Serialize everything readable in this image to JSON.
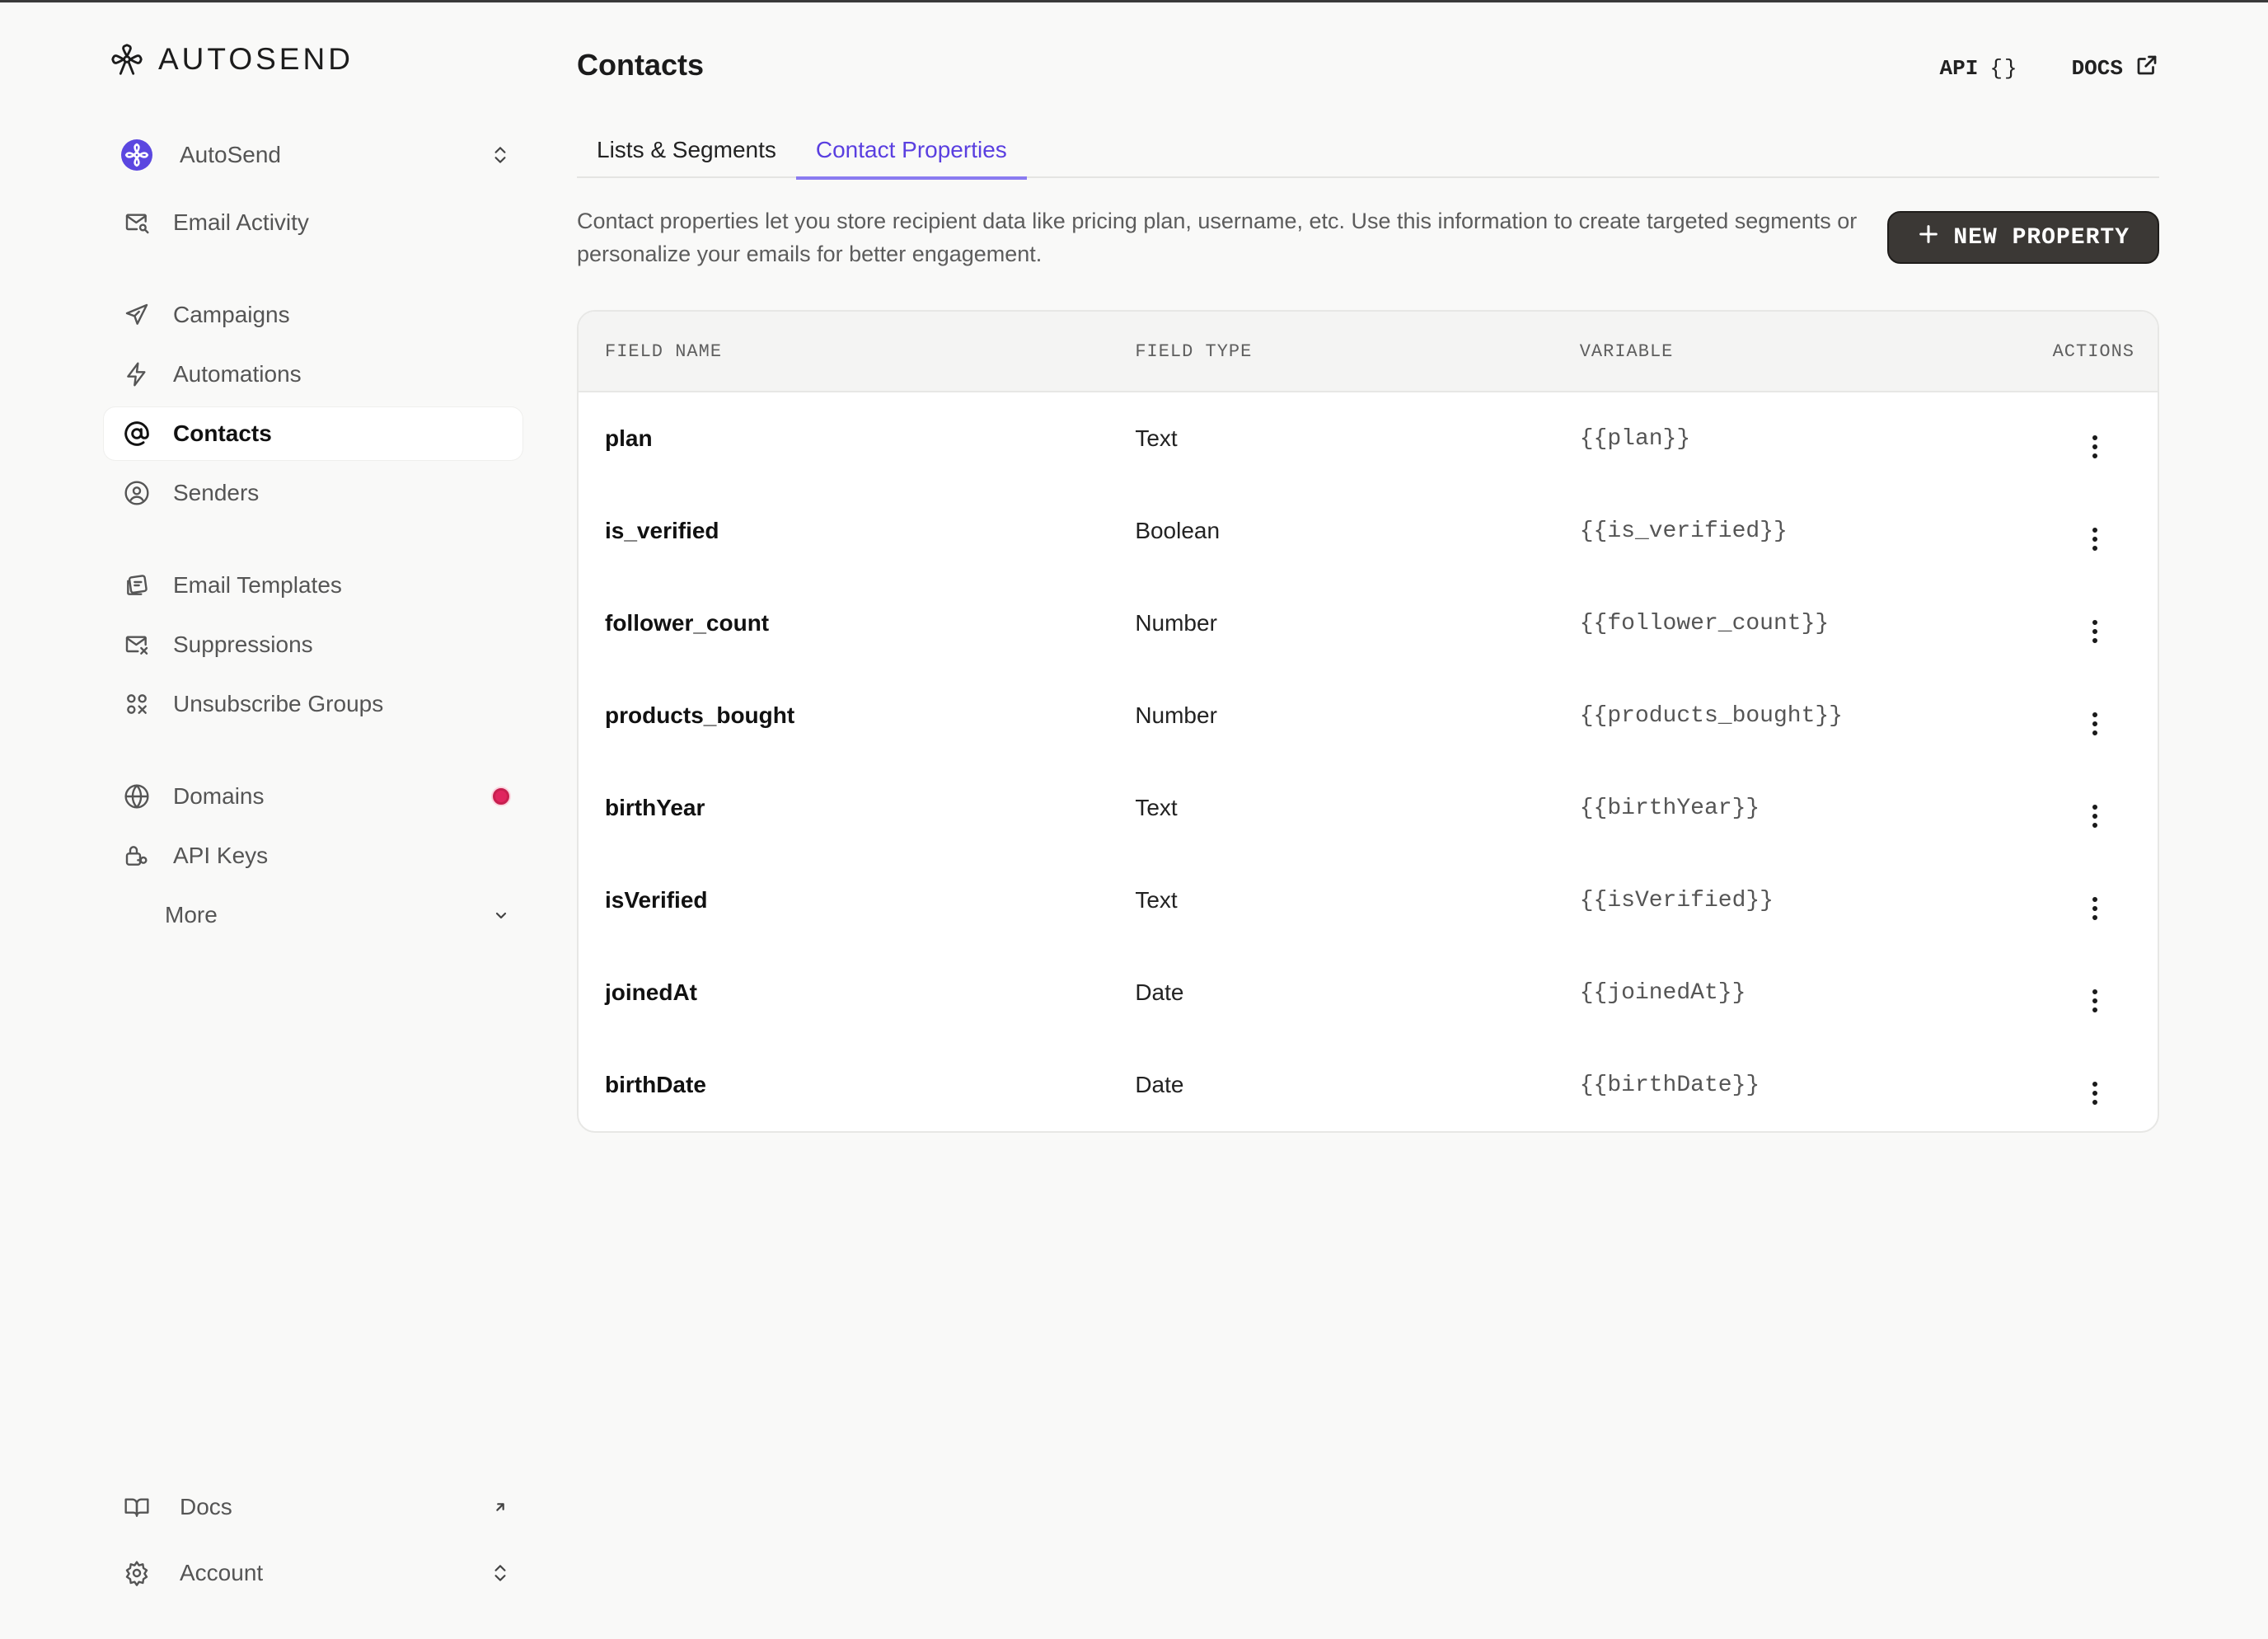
{
  "brand": {
    "name": "AUTOSEND"
  },
  "sidebar": {
    "workspace": {
      "label": "AutoSend"
    },
    "items": [
      {
        "label": "Email Activity",
        "icon": "mail-search-icon"
      },
      {
        "label": "Campaigns",
        "icon": "paper-plane-icon"
      },
      {
        "label": "Automations",
        "icon": "lightning-icon"
      },
      {
        "label": "Contacts",
        "icon": "at-sign-icon",
        "active": true
      },
      {
        "label": "Senders",
        "icon": "user-circle-icon"
      },
      {
        "label": "Email Templates",
        "icon": "template-icon"
      },
      {
        "label": "Suppressions",
        "icon": "mail-x-icon"
      },
      {
        "label": "Unsubscribe Groups",
        "icon": "groups-icon"
      },
      {
        "label": "Domains",
        "icon": "globe-icon",
        "alert": true
      },
      {
        "label": "API Keys",
        "icon": "key-lock-icon"
      },
      {
        "label": "More"
      }
    ],
    "footer": [
      {
        "label": "Docs",
        "icon": "book-icon"
      },
      {
        "label": "Account",
        "icon": "gear-icon"
      }
    ]
  },
  "header": {
    "title": "Contacts",
    "api_label": "API",
    "api_braces": "{}",
    "docs_label": "DOCS"
  },
  "tabs": [
    {
      "label": "Lists & Segments",
      "active": false
    },
    {
      "label": "Contact Properties",
      "active": true
    }
  ],
  "description": "Contact properties let you store recipient data like pricing plan, username, etc. Use this information to create targeted segments or personalize your emails for better engagement.",
  "new_property_label": "NEW PROPERTY",
  "table": {
    "headers": {
      "name": "FIELD NAME",
      "type": "FIELD TYPE",
      "variable": "VARIABLE",
      "actions": "ACTIONS"
    },
    "rows": [
      {
        "name": "plan",
        "type": "Text",
        "variable": "{{plan}}"
      },
      {
        "name": "is_verified",
        "type": "Boolean",
        "variable": "{{is_verified}}"
      },
      {
        "name": "follower_count",
        "type": "Number",
        "variable": "{{follower_count}}"
      },
      {
        "name": "products_bought",
        "type": "Number",
        "variable": "{{products_bought}}"
      },
      {
        "name": "birthYear",
        "type": "Text",
        "variable": "{{birthYear}}"
      },
      {
        "name": "isVerified",
        "type": "Text",
        "variable": "{{isVerified}}"
      },
      {
        "name": "joinedAt",
        "type": "Date",
        "variable": "{{joinedAt}}"
      },
      {
        "name": "birthDate",
        "type": "Date",
        "variable": "{{birthDate}}"
      }
    ]
  },
  "colors": {
    "accent": "#5a3fe0",
    "alert": "#e0245e",
    "button": "#3b3835"
  }
}
